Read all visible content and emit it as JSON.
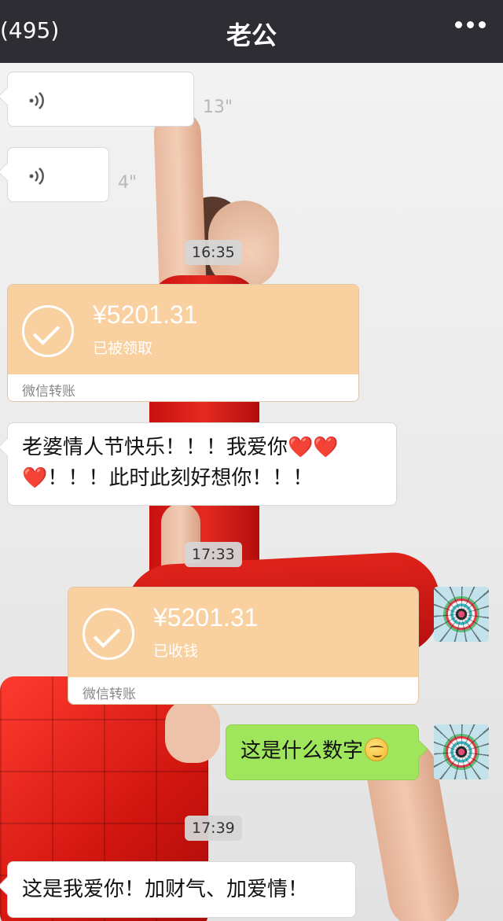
{
  "header": {
    "back_label": "(495)",
    "title": "老公",
    "more_icon": "more-dots-icon"
  },
  "messages": {
    "voice1": {
      "duration": "13\""
    },
    "voice2": {
      "duration": "4\""
    },
    "time1": "16:35",
    "transfer1": {
      "amount": "¥5201.31",
      "status": "已被领取",
      "label": "微信转账"
    },
    "text1": {
      "line1": "老婆情人节快乐！！！我爱你",
      "line2": "！！！此时此刻好想你！！！",
      "heart": "❤️"
    },
    "time2": "17:33",
    "transfer2": {
      "amount": "¥5201.31",
      "status": "已收钱",
      "label": "微信转账"
    },
    "text2": {
      "text": "这是什么数字"
    },
    "time3": "17:39",
    "text3": {
      "text": "这是我爱你！加财气、加爱情！"
    }
  },
  "colors": {
    "topbar": "#2d2d33",
    "transfer_orange": "#f9d0a0",
    "sent_bubble": "#9fe65d"
  }
}
